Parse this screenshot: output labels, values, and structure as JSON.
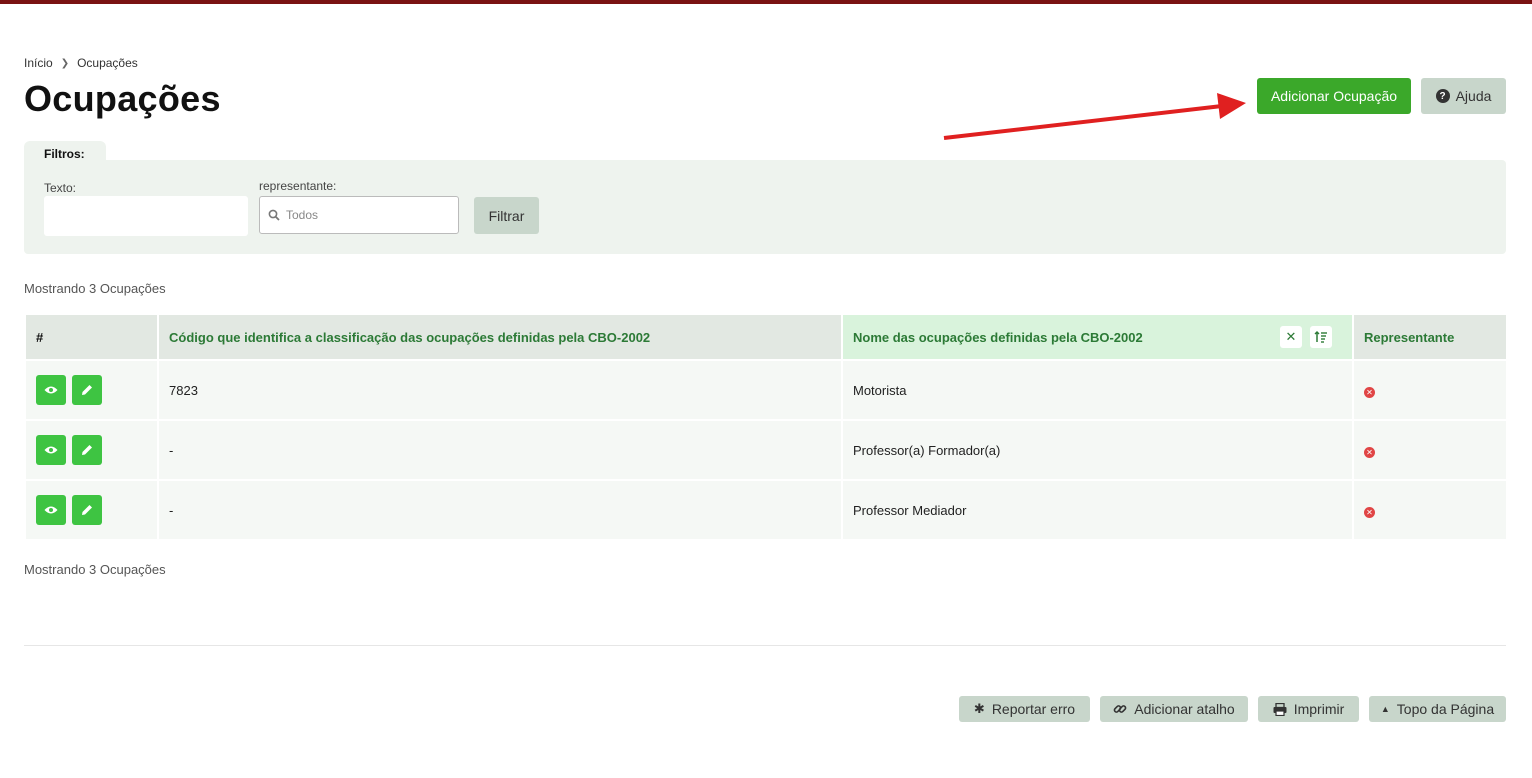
{
  "breadcrumb": {
    "home": "Início",
    "current": "Ocupações"
  },
  "page": {
    "title": "Ocupações"
  },
  "header_actions": {
    "add_label": "Adicionar Ocupação",
    "help_label": "Ajuda"
  },
  "filters": {
    "tab_label": "Filtros:",
    "text_label": "Texto:",
    "text_value": "",
    "rep_label": "representante:",
    "rep_placeholder": "Todos",
    "filter_button": "Filtrar"
  },
  "results": {
    "count_text": "Mostrando 3 Ocupações"
  },
  "table": {
    "headers": {
      "hash": "#",
      "code": "Código que identifica a classificação das ocupações definidas pela CBO-2002",
      "name": "Nome das ocupações definidas pela CBO-2002",
      "rep": "Representante"
    },
    "rows": [
      {
        "code": "7823",
        "name": "Motorista",
        "representante": false
      },
      {
        "code": "-",
        "name": "Professor(a) Formador(a)",
        "representante": false
      },
      {
        "code": "-",
        "name": "Professor Mediador",
        "representante": false
      }
    ]
  },
  "footer": {
    "report": "Reportar erro",
    "shortcut": "Adicionar atalho",
    "print": "Imprimir",
    "top": "Topo da Página"
  },
  "colors": {
    "brand": "#7a1212",
    "primary_green": "#3ba82a",
    "action_green": "#3ec442",
    "header_green_text": "#2c7a36",
    "error_red": "#e04545"
  }
}
